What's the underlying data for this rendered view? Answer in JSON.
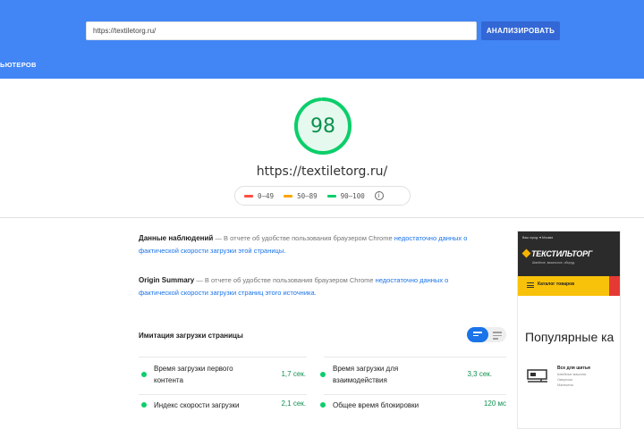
{
  "header": {
    "url_value": "https://textiletorg.ru/",
    "analyze_label": "АНАЛИЗИРОВАТЬ",
    "tab_label": "ЬЮТЕРОВ",
    "color": "#4285f4"
  },
  "summary": {
    "score": "98",
    "score_fraction": 0.98,
    "tested_url": "https://textiletorg.ru/",
    "legend": [
      {
        "label": "0–49",
        "color": "#ff4e42"
      },
      {
        "label": "50–89",
        "color": "#ffa400"
      },
      {
        "label": "90–100",
        "color": "#0cce6b"
      }
    ],
    "info_icon": "info-icon"
  },
  "field_data": {
    "title": "Данные наблюдений",
    "text": " — В отчете об удобстве пользования браузером Chrome ",
    "link": "недостаточно данных о фактической скорости загрузки этой страницы."
  },
  "origin_summary": {
    "title": "Origin Summary",
    "text": " — В отчете об удобстве пользования браузером Chrome ",
    "link": "недостаточно данных о фактической скорости загрузки страниц этого источника."
  },
  "lab_data": {
    "title": "Имитация загрузки страницы",
    "metrics": [
      {
        "label": "Время загрузки первого контента",
        "value": "1,7 сек."
      },
      {
        "label": "Время загрузки для взаимодействия",
        "value": "3,3 сек."
      },
      {
        "label": "Индекс скорости загрузки",
        "value": "2,1 сек."
      },
      {
        "label": "Общее время блокировки",
        "value": "120 мс"
      }
    ]
  },
  "preview": {
    "topbar_text": "Ваш город: ♥ Москва",
    "logo": "ТЕКСТИЛЬТОРГ",
    "tagline": "Швейное, вязальное, оборуд.",
    "catalog_button": "Каталог товаров",
    "heading": "Популярные ка",
    "category_title": "Все для шитья",
    "category_items": [
      "Швейные машины",
      "Оверлоки",
      "Манекены"
    ]
  }
}
